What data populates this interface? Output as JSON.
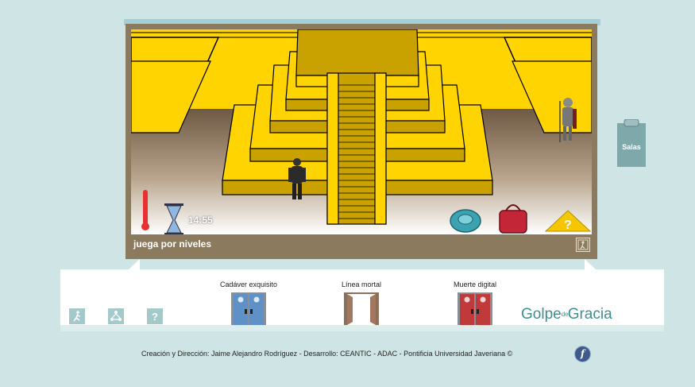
{
  "game": {
    "status_text": "juega por niveles",
    "timer": "14:55"
  },
  "salas": {
    "label": "Salas"
  },
  "rooms": [
    {
      "label": "Cadáver exquisito",
      "door_color": "#5f90c8"
    },
    {
      "label": "Línea mortal",
      "door_color": "#ffffff"
    },
    {
      "label": "Muerte digital",
      "door_color": "#c0393b"
    }
  ],
  "tools": {
    "exit_icon": "running-man-icon",
    "share_icon": "network-icon",
    "help_label": "?"
  },
  "logo": {
    "word1": "Golpe",
    "connector": "de",
    "word2": "Gracia"
  },
  "credits": "Creación y Dirección: Jaime Alejandro Rodríguez - Desarrollo: CEANTIC - ADAC - Pontificia Universidad Javeriana ©",
  "colors": {
    "page_bg": "#cfe4e4",
    "frame": "#8b7a5e",
    "sand": "#ffd400",
    "pyramid": "#c9a200",
    "teal": "#a3c9cb"
  }
}
